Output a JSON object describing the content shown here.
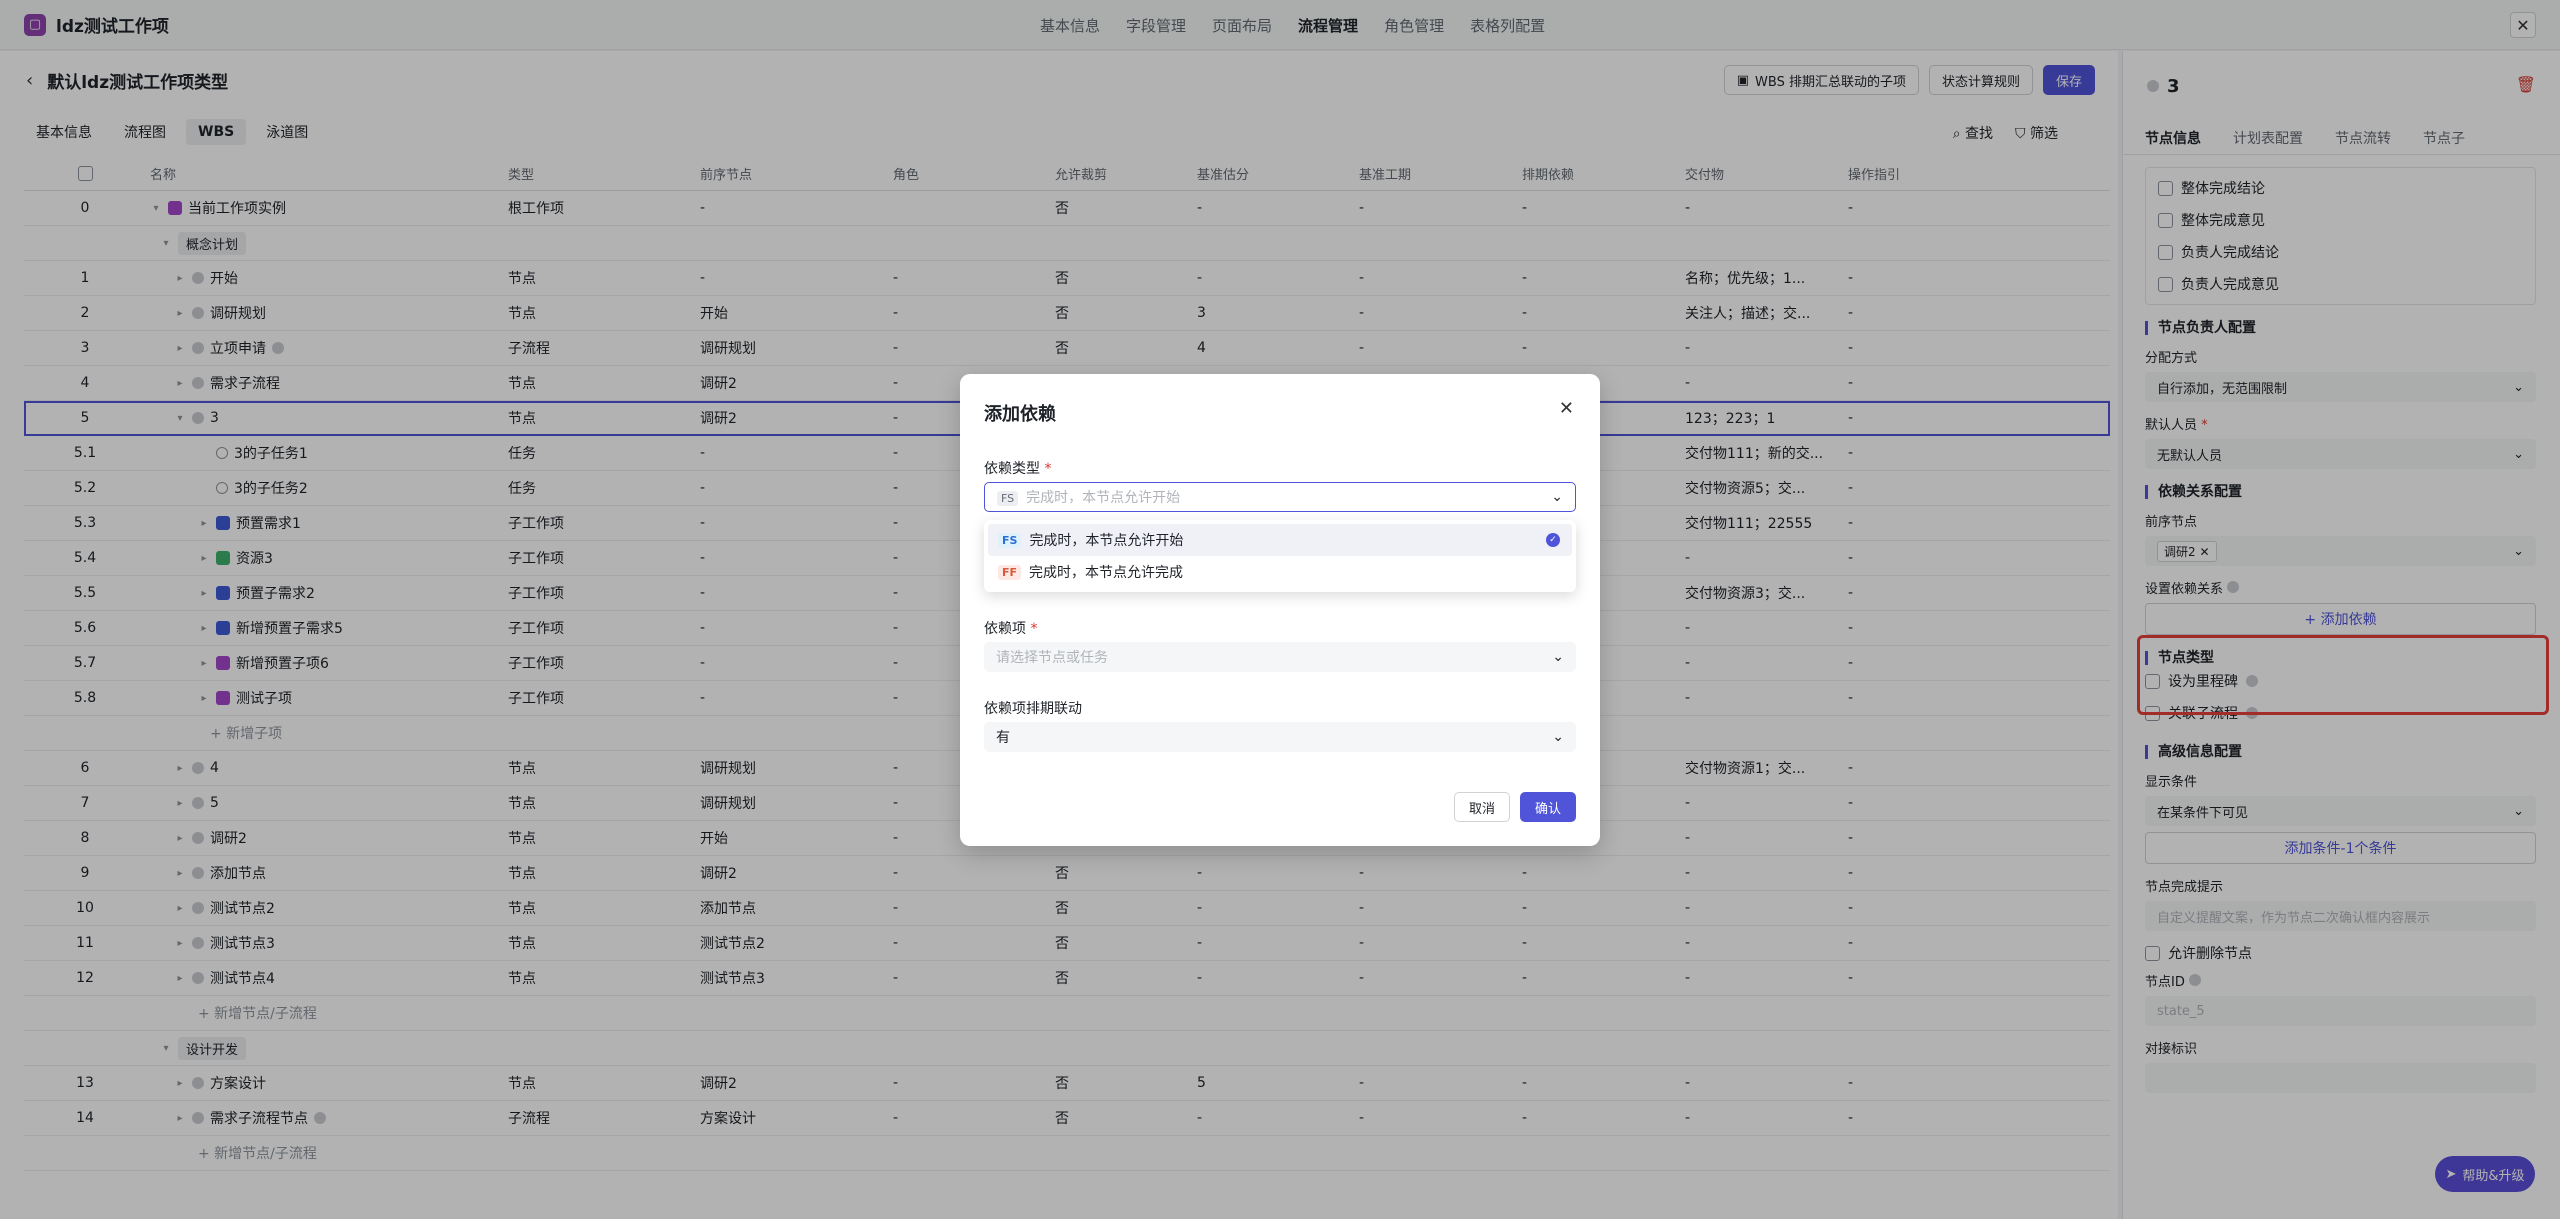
{
  "app": {
    "logo": "▢",
    "title": "ldz测试工作项"
  },
  "top_nav": [
    "基本信息",
    "字段管理",
    "页面布局",
    "流程管理",
    "角色管理",
    "表格列配置"
  ],
  "top_nav_active": 3,
  "top_close": "✕",
  "page": {
    "back": "‹",
    "title": "默认ldz测试工作项类型"
  },
  "header_buttons": {
    "wbs": "WBS 排期汇总联动的子项",
    "status_rule": "状态计算规则",
    "save": "保存"
  },
  "subtabs": [
    "基本信息",
    "流程图",
    "WBS",
    "泳道图"
  ],
  "subtabs_active": 2,
  "tools": {
    "find": "查找",
    "filter": "筛选"
  },
  "table": {
    "headers": [
      "名称",
      "类型",
      "前序节点",
      "角色",
      "允许裁剪",
      "基准估分",
      "基准工期",
      "排期依赖",
      "交付物",
      "操作指引"
    ],
    "rows": [
      {
        "idx": "0",
        "name": "当前工作项实例",
        "type": "根工作项",
        "prev": "-",
        "role": "",
        "cut": "否",
        "est": "-",
        "dur": "-",
        "dep": "-",
        "del": "-",
        "guide": "-"
      },
      {
        "idx": "",
        "name": "概念计划",
        "type": "",
        "prev": "",
        "role": "",
        "cut": "",
        "est": "",
        "dur": "",
        "dep": "",
        "del": "",
        "guide": ""
      },
      {
        "idx": "1",
        "name": "开始",
        "type": "节点",
        "prev": "-",
        "role": "-",
        "cut": "否",
        "est": "-",
        "dur": "-",
        "dep": "-",
        "del": "名称；优先级；1...",
        "guide": "-"
      },
      {
        "idx": "2",
        "name": "调研规划",
        "type": "节点",
        "prev": "开始",
        "role": "-",
        "cut": "否",
        "est": "3",
        "dur": "-",
        "dep": "-",
        "del": "关注人；描述；交...",
        "guide": "-"
      },
      {
        "idx": "3",
        "name": "立项申请",
        "type": "子流程",
        "prev": "调研规划",
        "role": "-",
        "cut": "否",
        "est": "4",
        "dur": "-",
        "dep": "-",
        "del": "-",
        "guide": "-"
      },
      {
        "idx": "4",
        "name": "需求子流程",
        "type": "节点",
        "prev": "调研2",
        "role": "-",
        "cut": "",
        "est": "",
        "dur": "",
        "dep": "",
        "del": "-",
        "guide": "-"
      },
      {
        "idx": "5",
        "name": "3",
        "type": "节点",
        "prev": "调研2",
        "role": "-",
        "cut": "",
        "est": "",
        "dur": "",
        "dep": "",
        "del": "123；223；1",
        "guide": "-"
      },
      {
        "idx": "5.1",
        "name": "3的子任务1",
        "type": "任务",
        "prev": "-",
        "role": "-",
        "cut": "",
        "est": "",
        "dur": "",
        "dep": "",
        "del": "交付物111；新的交...",
        "guide": "-"
      },
      {
        "idx": "5.2",
        "name": "3的子任务2",
        "type": "任务",
        "prev": "-",
        "role": "-",
        "cut": "",
        "est": "",
        "dur": "",
        "dep": "",
        "del": "交付物资源5；交...",
        "guide": "-"
      },
      {
        "idx": "5.3",
        "name": "预置需求1",
        "type": "子工作项",
        "prev": "-",
        "role": "-",
        "cut": "",
        "est": "",
        "dur": "",
        "dep": "",
        "del": "交付物111；22555",
        "guide": "-"
      },
      {
        "idx": "5.4",
        "name": "资源3",
        "type": "子工作项",
        "prev": "-",
        "role": "-",
        "cut": "",
        "est": "",
        "dur": "",
        "dep": "",
        "del": "-",
        "guide": "-"
      },
      {
        "idx": "5.5",
        "name": "预置子需求2",
        "type": "子工作项",
        "prev": "-",
        "role": "-",
        "cut": "",
        "est": "",
        "dur": "",
        "dep": "",
        "del": "交付物资源3；交...",
        "guide": "-"
      },
      {
        "idx": "5.6",
        "name": "新增预置子需求5",
        "type": "子工作项",
        "prev": "-",
        "role": "-",
        "cut": "",
        "est": "",
        "dur": "",
        "dep": "",
        "del": "-",
        "guide": "-"
      },
      {
        "idx": "5.7",
        "name": "新增预置子项6",
        "type": "子工作项",
        "prev": "-",
        "role": "-",
        "cut": "",
        "est": "",
        "dur": "",
        "dep": "",
        "del": "-",
        "guide": "-"
      },
      {
        "idx": "5.8",
        "name": "测试子项",
        "type": "子工作项",
        "prev": "-",
        "role": "-",
        "cut": "",
        "est": "",
        "dur": "",
        "dep": "",
        "del": "-",
        "guide": "-"
      },
      {
        "idx": "",
        "name": "+ 新增子项",
        "type": "",
        "prev": "",
        "role": "",
        "cut": "",
        "est": "",
        "dur": "",
        "dep": "",
        "del": "",
        "guide": ""
      },
      {
        "idx": "6",
        "name": "4",
        "type": "节点",
        "prev": "调研规划",
        "role": "-",
        "cut": "",
        "est": "",
        "dur": "",
        "dep": "",
        "del": "交付物资源1；交...",
        "guide": "-"
      },
      {
        "idx": "7",
        "name": "5",
        "type": "节点",
        "prev": "调研规划",
        "role": "-",
        "cut": "",
        "est": "",
        "dur": "",
        "dep": "",
        "del": "-",
        "guide": "-"
      },
      {
        "idx": "8",
        "name": "调研2",
        "type": "节点",
        "prev": "开始",
        "role": "-",
        "cut": "",
        "est": "",
        "dur": "",
        "dep": "",
        "del": "-",
        "guide": "-"
      },
      {
        "idx": "9",
        "name": "添加节点",
        "type": "节点",
        "prev": "调研2",
        "role": "-",
        "cut": "否",
        "est": "-",
        "dur": "-",
        "dep": "-",
        "del": "-",
        "guide": "-"
      },
      {
        "idx": "10",
        "name": "测试节点2",
        "type": "节点",
        "prev": "添加节点",
        "role": "-",
        "cut": "否",
        "est": "-",
        "dur": "-",
        "dep": "-",
        "del": "-",
        "guide": "-"
      },
      {
        "idx": "11",
        "name": "测试节点3",
        "type": "节点",
        "prev": "测试节点2",
        "role": "-",
        "cut": "否",
        "est": "-",
        "dur": "-",
        "dep": "-",
        "del": "-",
        "guide": "-"
      },
      {
        "idx": "12",
        "name": "测试节点4",
        "type": "节点",
        "prev": "测试节点3",
        "role": "-",
        "cut": "否",
        "est": "-",
        "dur": "-",
        "dep": "-",
        "del": "-",
        "guide": "-"
      },
      {
        "idx": "",
        "name": "+ 新增节点/子流程",
        "type": "",
        "prev": "",
        "role": "",
        "cut": "",
        "est": "",
        "dur": "",
        "dep": "",
        "del": "",
        "guide": ""
      },
      {
        "idx": "",
        "name": "设计开发",
        "type": "",
        "prev": "",
        "role": "",
        "cut": "",
        "est": "",
        "dur": "",
        "dep": "",
        "del": "",
        "guide": ""
      },
      {
        "idx": "13",
        "name": "方案设计",
        "type": "节点",
        "prev": "调研2",
        "role": "-",
        "cut": "否",
        "est": "5",
        "dur": "-",
        "dep": "-",
        "del": "-",
        "guide": "-"
      },
      {
        "idx": "14",
        "name": "需求子流程节点",
        "type": "子流程",
        "prev": "方案设计",
        "role": "-",
        "cut": "否",
        "est": "-",
        "dur": "-",
        "dep": "-",
        "del": "-",
        "guide": "-"
      },
      {
        "idx": "",
        "name": "+ 新增节点/子流程",
        "type": "",
        "prev": "",
        "role": "",
        "cut": "",
        "est": "",
        "dur": "",
        "dep": "",
        "del": "",
        "guide": ""
      }
    ]
  },
  "right_panel": {
    "title": "3",
    "delete_icon": "🗑",
    "tabs": [
      "节点信息",
      "计划表配置",
      "节点流转",
      "节点子"
    ],
    "top_checks": [
      "整体完成结论",
      "整体完成意见",
      "负责人完成结论",
      "负责人完成意见"
    ],
    "owner_section": "节点负责人配置",
    "assign_label": "分配方式",
    "assign_value": "自行添加，无范围限制",
    "default_user_label": "默认人员",
    "default_user_value": "无默认人员",
    "dep_section": "依赖关系配置",
    "prev_label": "前序节点",
    "prev_tag": "调研2",
    "set_dep_label": "设置依赖关系",
    "add_dep_btn": "+ 添加依赖",
    "node_type_section": "节点类型",
    "milestone": "设为里程碑",
    "link_flow": "关联子流程",
    "advanced_section": "高级信息配置",
    "display_cond_label": "显示条件",
    "display_cond_value": "在某条件下可见",
    "add_cond": "添加条件-1个条件",
    "finish_hint_label": "节点完成提示",
    "finish_hint_placeholder": "自定义提醒文案，作为节点二次确认框内容展示",
    "allow_delete": "允许删除节点",
    "node_id_label": "节点ID",
    "node_id_value": "state_5",
    "mark_label": "对接标识"
  },
  "help": "帮助&升级",
  "modal": {
    "title": "添加依赖",
    "close": "✕",
    "dep_type_label": "依赖类型",
    "dep_type_badge": "FS",
    "dep_type_placeholder": "完成时，本节点允许开始",
    "options": [
      {
        "badge": "FS",
        "label": "完成时，本节点允许开始",
        "selected": true
      },
      {
        "badge": "FF",
        "label": "完成时，本节点允许完成",
        "selected": false
      }
    ],
    "dep_item_label": "依赖项",
    "dep_item_placeholder": "请选择节点或任务",
    "sync_label": "依赖项排期联动",
    "sync_value": "有",
    "cancel": "取消",
    "confirm": "确认"
  }
}
